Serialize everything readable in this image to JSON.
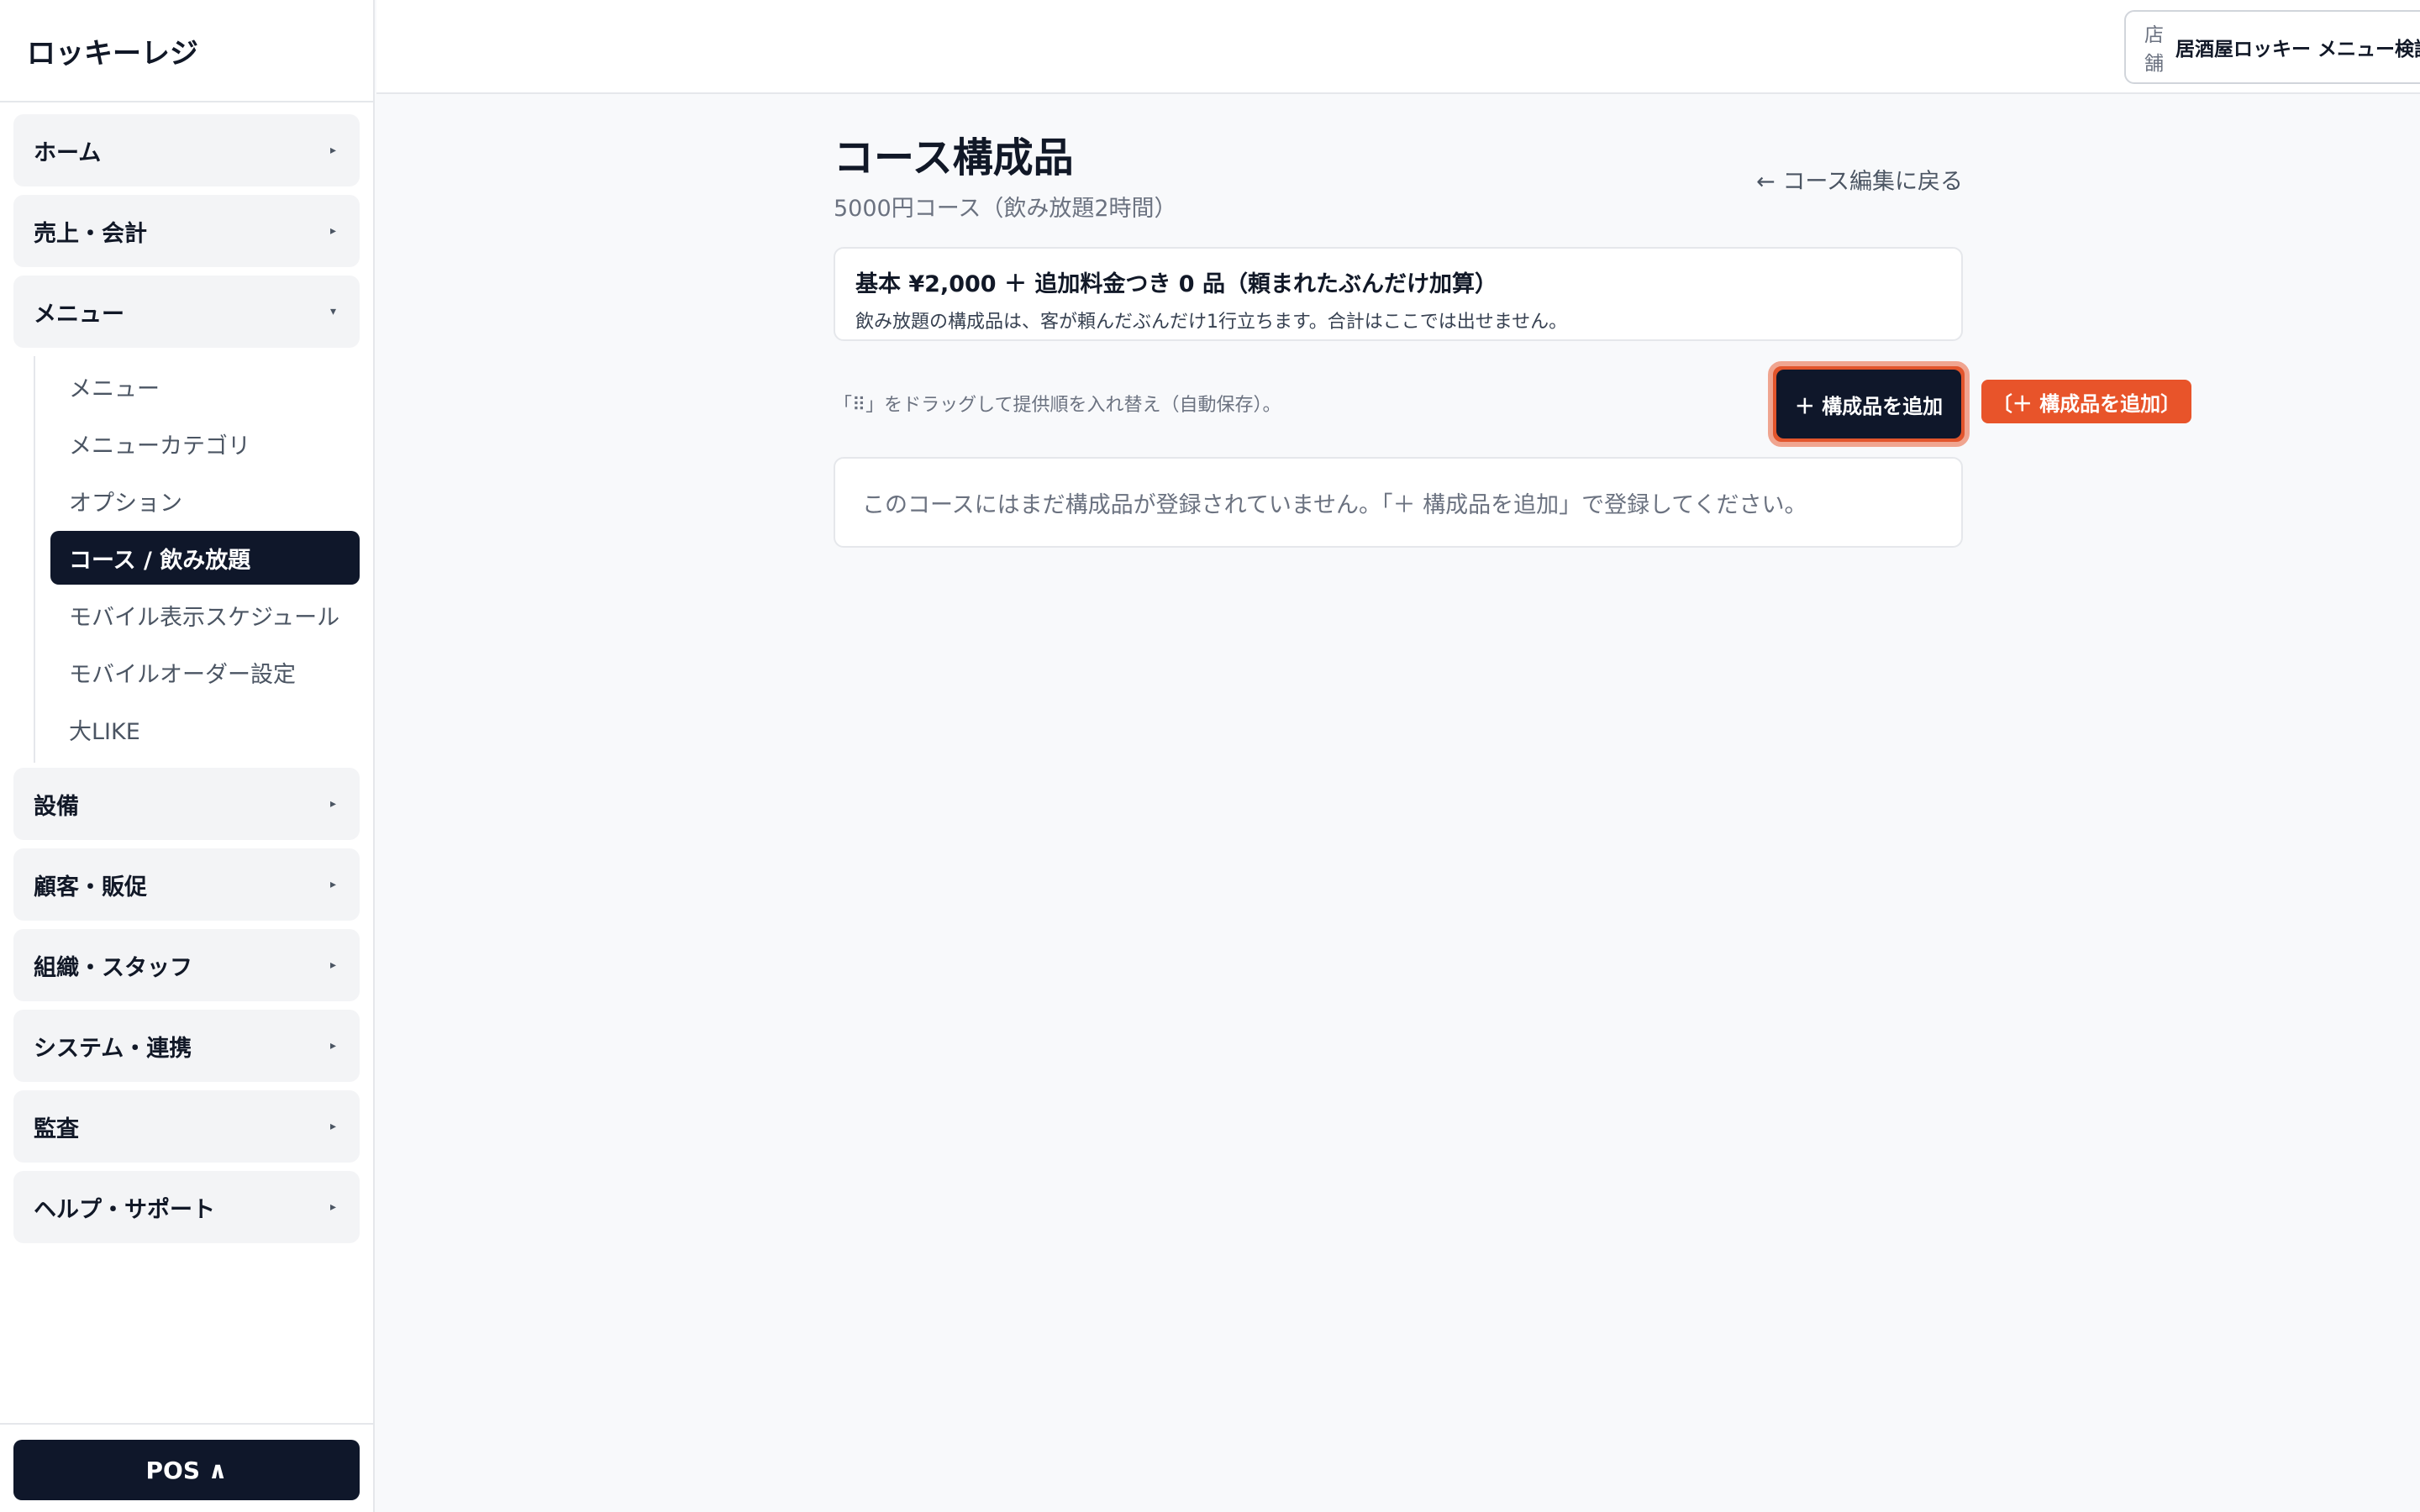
{
  "app": {
    "brand": "ロッキーレジ"
  },
  "sidebar": {
    "groups": [
      {
        "label": "ホーム",
        "caret": "▸"
      },
      {
        "label": "売上・会計",
        "caret": "▸"
      },
      {
        "label": "メニュー",
        "caret": "▾"
      },
      {
        "label": "設備",
        "caret": "▸"
      },
      {
        "label": "顧客・販促",
        "caret": "▸"
      },
      {
        "label": "組織・スタッフ",
        "caret": "▸"
      },
      {
        "label": "システム・連携",
        "caret": "▸"
      },
      {
        "label": "監査",
        "caret": "▸"
      },
      {
        "label": "ヘルプ・サポート",
        "caret": "▸"
      }
    ],
    "menu_items": [
      {
        "label": "メニュー"
      },
      {
        "label": "メニューカテゴリ"
      },
      {
        "label": "オプション"
      },
      {
        "label": "コース / 飲み放題",
        "active": true
      },
      {
        "label": "モバイル表示スケジュール"
      },
      {
        "label": "モバイルオーダー設定"
      },
      {
        "label": "大LIKE"
      }
    ],
    "footer_button": "POS ∧"
  },
  "header": {
    "store_label": "店舗",
    "store_value": "居酒屋ロッキー メニュー検証店",
    "chevron_icon": "chevron-down-icon"
  },
  "main": {
    "title": "コース構成品",
    "subtitle": "5000円コース（飲み放題2時間）",
    "back_link": "← コース編集に戻る",
    "summary": {
      "main": "基本 ¥2,000 ＋ 追加料金つき 0 品（頼まれたぶんだけ加算）",
      "note": "飲み放題の構成品は、客が頼んだぶんだけ1行立ちます。合計はここでは出せません。"
    },
    "hint": "「⠿」をドラッグして提供順を入れ替え（自動保存）。",
    "add_button": "＋ 構成品を追加",
    "add_tag": "〔＋ 構成品を追加〕",
    "empty_message": "このコースにはまだ構成品が登録されていません。「＋ 構成品を追加」で登録してください。"
  },
  "colors": {
    "accent_dark": "#0f172a",
    "highlight_orange": "#e8542a"
  }
}
